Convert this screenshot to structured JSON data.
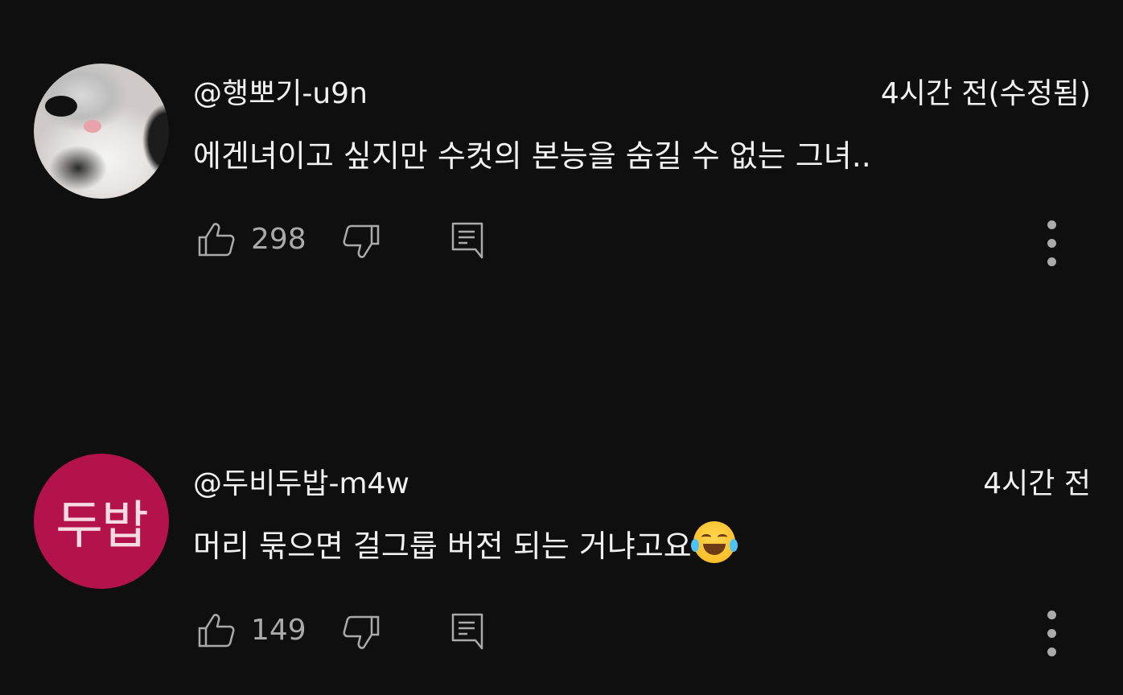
{
  "comments": [
    {
      "username": "@행뽀기-u9n",
      "time": "4시간 전(수정됨)",
      "text": "에겐녀이고 싶지만 수컷의 본능을 숨길 수 없는 그녀..",
      "like_count": "298",
      "avatar": "cat-photo"
    },
    {
      "username": "@두비두밥-m4w",
      "time": "4시간 전",
      "text": "머리 묶으면 걸그룹 버전 되는 거냐고요",
      "emoji": "face-with-tears-of-joy",
      "like_count": "149",
      "avatar_text": "두밥",
      "avatar_color": "#b3134a"
    }
  ],
  "icons": {
    "like": "thumbs-up-icon",
    "dislike": "thumbs-down-icon",
    "reply": "reply-comment-icon",
    "more": "more-vertical-icon"
  }
}
